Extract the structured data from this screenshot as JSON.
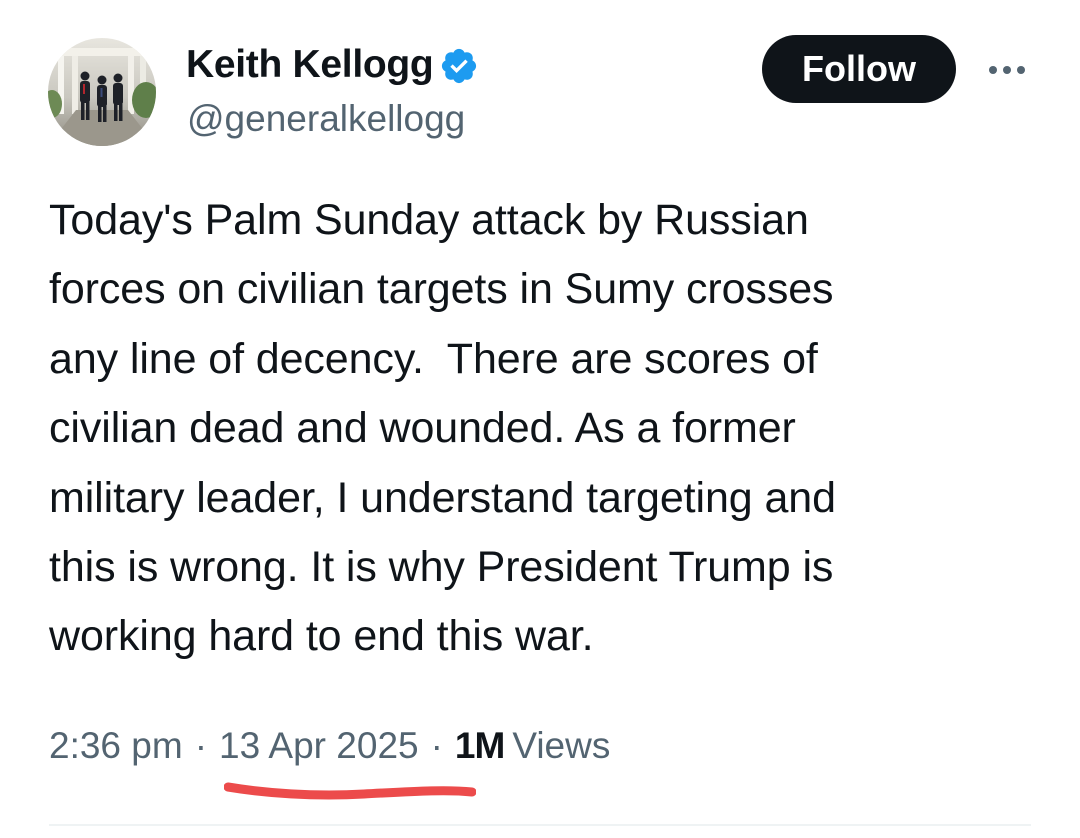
{
  "author": {
    "display_name": "Keith Kellogg",
    "handle": "@generalkellogg",
    "verified": true,
    "verified_color": "#1d9bf0",
    "avatar_icon": "profile-photo"
  },
  "actions": {
    "follow_label": "Follow",
    "more_icon": "ellipsis-icon"
  },
  "tweet": {
    "text": "Today's Palm Sunday attack by Russian\nforces on civilian targets in Sumy crosses\nany line of decency.  There are scores of\ncivilian dead and wounded. As a former\nmilitary leader, I understand targeting and\nthis is wrong. It is why President Trump is\nworking hard to end this war."
  },
  "meta": {
    "time": "2:36 pm",
    "separator": "·",
    "date": "13 Apr 2025",
    "views_count": "1M",
    "views_label": "Views"
  },
  "annotation": {
    "underline_color": "#ec4b4b"
  },
  "colors": {
    "text_primary": "#0f1419",
    "text_secondary": "#536471",
    "button_bg": "#0f1419",
    "button_text": "#ffffff",
    "divider": "#eff3f4"
  }
}
